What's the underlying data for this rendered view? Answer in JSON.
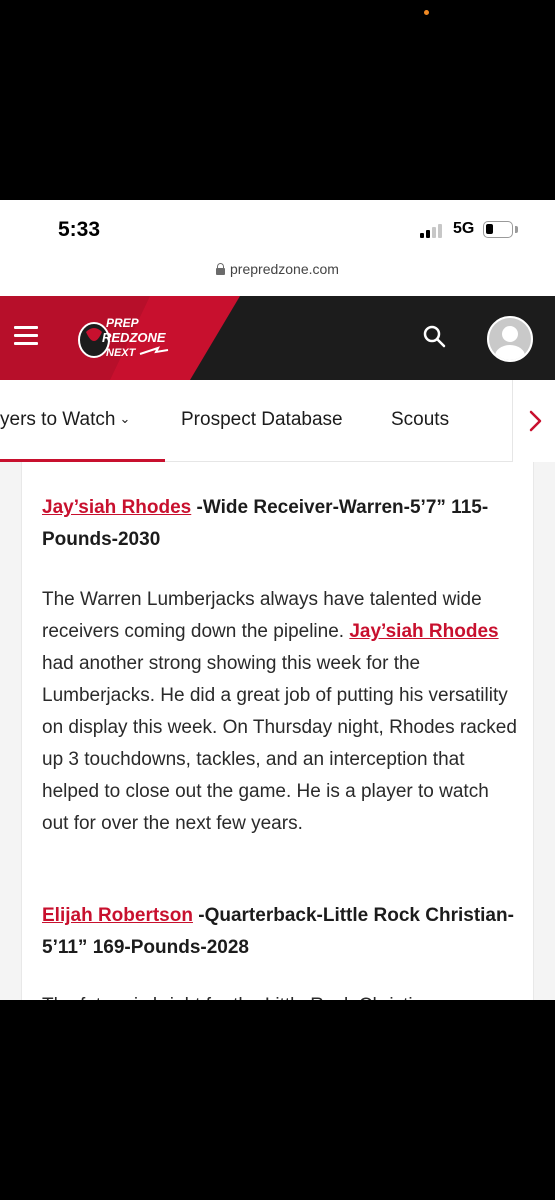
{
  "status_bar": {
    "time": "5:33",
    "network": "5G",
    "signal_bars_active": 2,
    "signal_bars_total": 4,
    "battery_level": 0.25
  },
  "browser": {
    "url": "prepredzone.com",
    "lock_icon": "lock-icon"
  },
  "header": {
    "logo_lines": [
      "PREP",
      "REDZONE",
      "NEXT"
    ],
    "brand_red": "#c8102e",
    "header_bg": "#1c1c1c",
    "menu_icon": "hamburger-icon",
    "search_icon": "search-icon",
    "avatar_icon": "user-avatar-icon"
  },
  "nav": {
    "tabs": [
      {
        "label": "yers to Watch",
        "caret": "⌄",
        "active": true
      },
      {
        "label": "Prospect Database",
        "active": false
      },
      {
        "label": "Scouts",
        "active": false
      }
    ],
    "next_icon": "chevron-right-icon"
  },
  "article": {
    "player1": {
      "name": "Jay’siah Rhodes",
      "details": " -Wide Receiver-Warren-5’7” 115-Pounds-2030",
      "body_before": "The Warren Lumberjacks always have talented wide receivers coming down the pipeline. ",
      "body_link": "Jay’siah Rhodes",
      "body_after": " had another strong showing this week for the Lumberjacks. He did a great job of putting his versatility on display this week. On Thursday night, Rhodes racked up 3 touchdowns, tackles, and an interception that helped to close out the game. He is a player to watch out for over the next few years."
    },
    "player2": {
      "name": "Elijah Robertson",
      "details": " -Quarterback-Little Rock Christian-5’11” 169-Pounds-2028",
      "body_cutoff": "The future is bright for the Little Rock Christian"
    }
  }
}
